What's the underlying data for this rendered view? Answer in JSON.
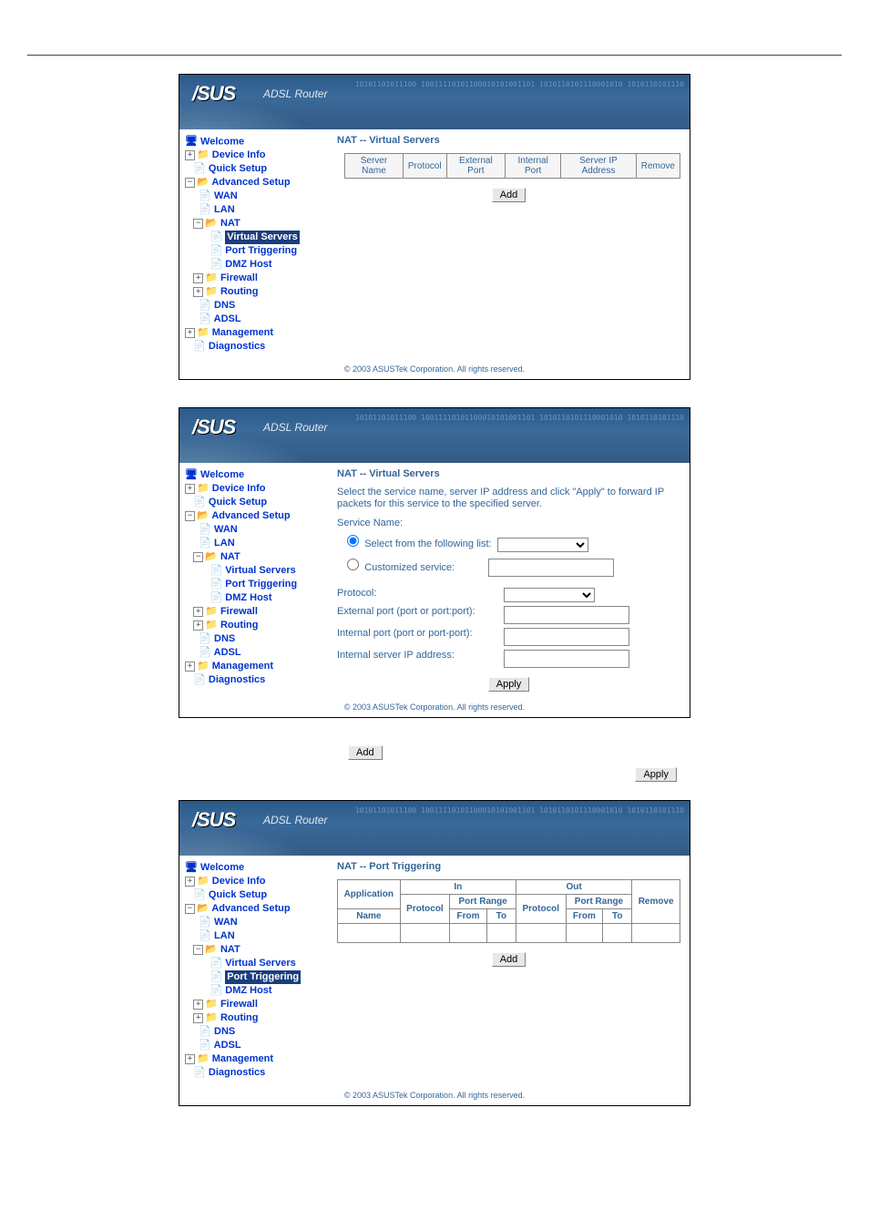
{
  "branding": {
    "logo": "/SUS",
    "subtitle": "ADSL Router"
  },
  "header_binary": "10101101011100\n10011110101100010101001101\n1010110101110001010\n1010110101110",
  "tree": {
    "welcome": "Welcome",
    "device_info": "Device Info",
    "quick_setup": "Quick Setup",
    "advanced_setup": "Advanced Setup",
    "wan": "WAN",
    "lan": "LAN",
    "nat": "NAT",
    "virtual_servers": "Virtual Servers",
    "port_triggering": "Port Triggering",
    "dmz_host": "DMZ Host",
    "firewall": "Firewall",
    "routing": "Routing",
    "dns": "DNS",
    "adsl": "ADSL",
    "management": "Management",
    "diagnostics": "Diagnostics"
  },
  "panel1": {
    "title": "NAT -- Virtual Servers",
    "columns": [
      "Server Name",
      "Protocol",
      "External Port",
      "Internal Port",
      "Server IP Address",
      "Remove"
    ],
    "add_label": "Add"
  },
  "panel2": {
    "title": "NAT -- Virtual Servers",
    "desc": "Select the service name, server IP address and click \"Apply\" to forward IP packets for this service to the specified server.",
    "service_name_label": "Service Name:",
    "opt_select_list": "Select from the following list:",
    "opt_custom": "Customized service:",
    "protocol_label": "Protocol:",
    "ext_port_label": "External port (port or port:port):",
    "int_port_label": "Internal port (port or port-port):",
    "int_ip_label": "Internal server IP address:",
    "apply_label": "Apply"
  },
  "buttons": {
    "add": "Add",
    "apply": "Apply"
  },
  "panel3": {
    "title": "NAT -- Port Triggering",
    "head": {
      "application": "Application",
      "in": "In",
      "out": "Out",
      "remove": "Remove",
      "name": "Name",
      "protocol": "Protocol",
      "port_range": "Port Range",
      "from": "From",
      "to": "To"
    },
    "add_label": "Add"
  },
  "footer": "© 2003 ASUSTek Corporation. All rights reserved."
}
